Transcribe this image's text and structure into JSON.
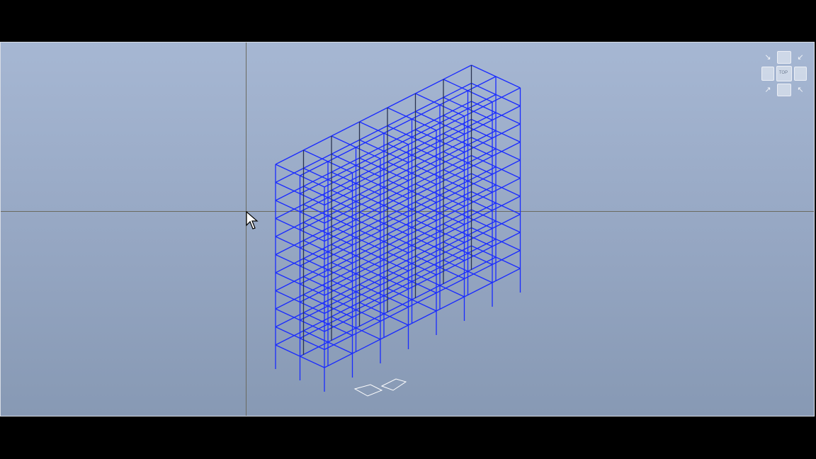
{
  "viewport": {
    "name": "3d-structural-view",
    "background": "#9aabc7",
    "frame_color": "#1a2bff"
  },
  "viewcube": {
    "top_label": "TOP"
  },
  "cursor": {
    "icon": "arrow-pointer-icon"
  }
}
